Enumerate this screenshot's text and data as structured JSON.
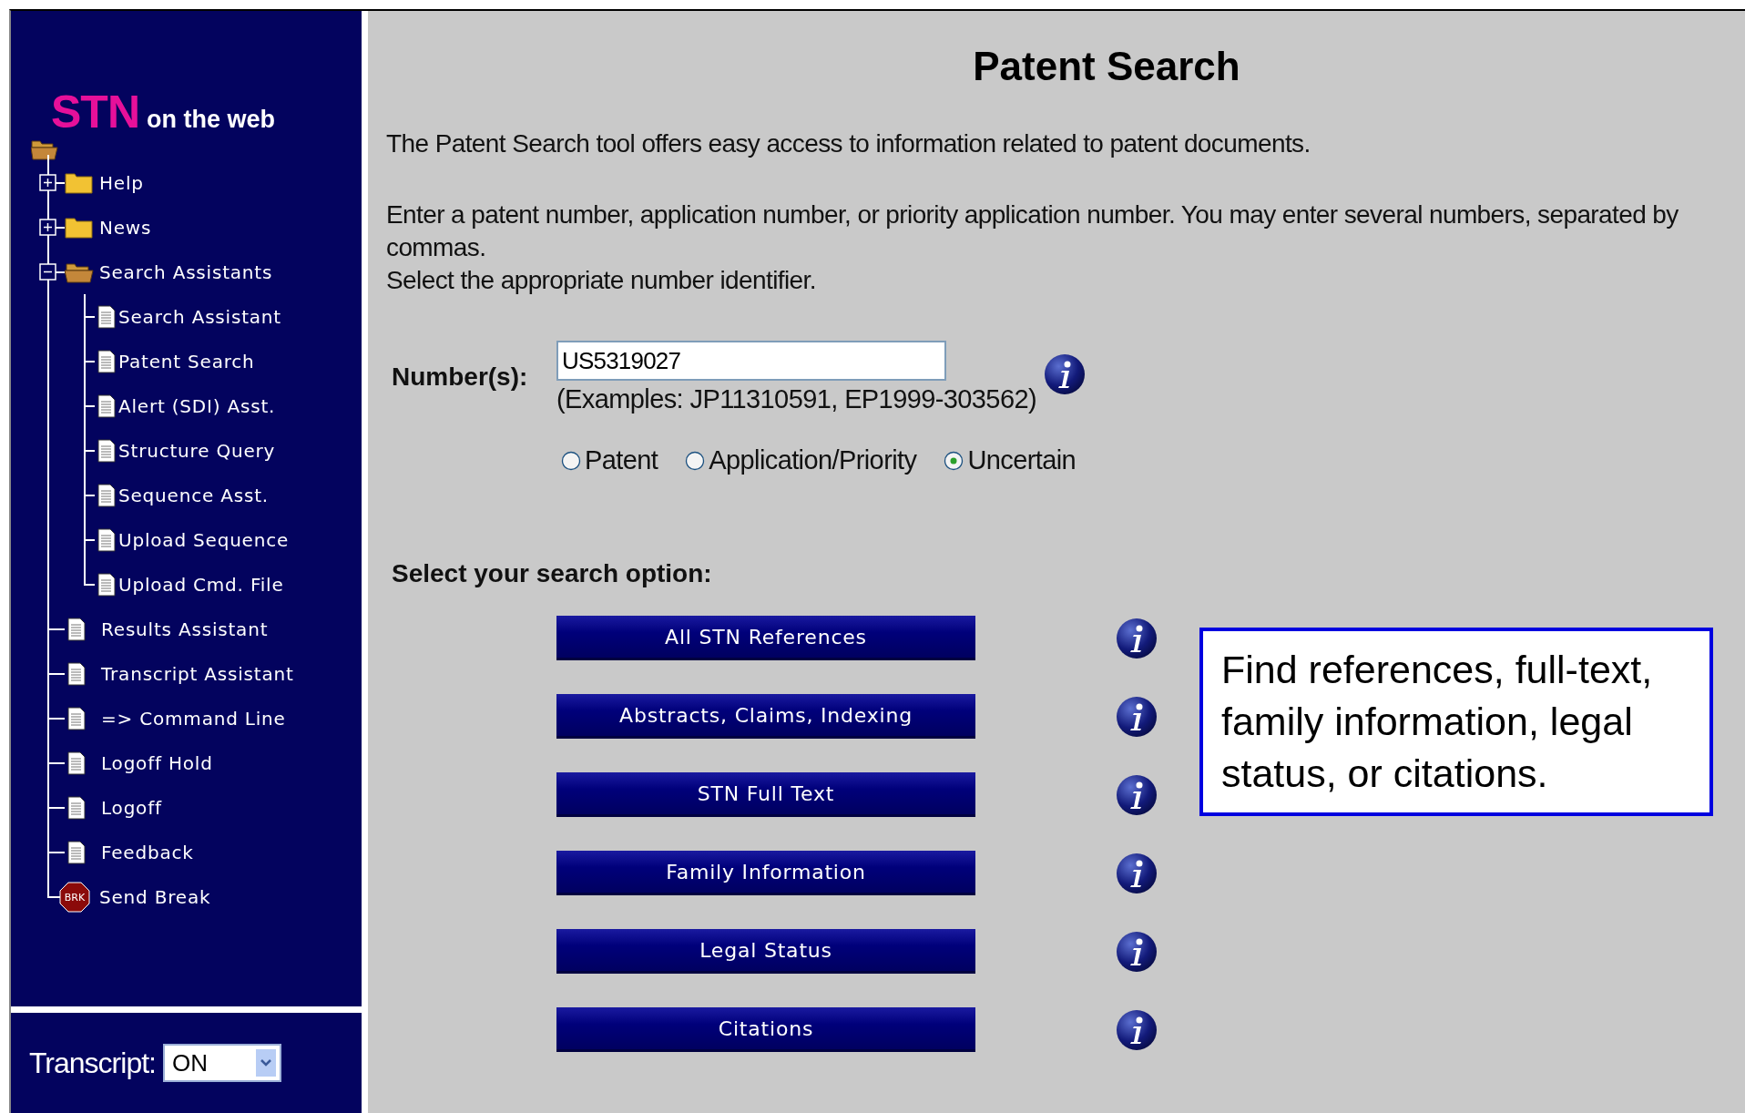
{
  "logo": {
    "brand": "STN",
    "tagline": "on the web"
  },
  "tree": [
    {
      "label": "Help",
      "kind": "folder",
      "expanded": false
    },
    {
      "label": "News",
      "kind": "folder",
      "expanded": false
    },
    {
      "label": "Search Assistants",
      "kind": "folder",
      "expanded": true,
      "children": [
        {
          "label": "Search Assistant",
          "kind": "page"
        },
        {
          "label": "Patent Search",
          "kind": "page"
        },
        {
          "label": "Alert (SDI) Asst.",
          "kind": "page"
        },
        {
          "label": "Structure Query",
          "kind": "page"
        },
        {
          "label": "Sequence Asst.",
          "kind": "page"
        },
        {
          "label": "Upload Sequence",
          "kind": "page"
        },
        {
          "label": "Upload Cmd. File",
          "kind": "page"
        }
      ]
    },
    {
      "label": "Results Assistant",
      "kind": "page"
    },
    {
      "label": "Transcript Assistant",
      "kind": "page"
    },
    {
      "label": "=> Command Line",
      "kind": "page"
    },
    {
      "label": "Logoff Hold",
      "kind": "page"
    },
    {
      "label": "Logoff",
      "kind": "page"
    },
    {
      "label": "Feedback",
      "kind": "page"
    },
    {
      "label": "Send Break",
      "kind": "break",
      "badge": "BRK"
    }
  ],
  "transcript": {
    "label": "Transcript:",
    "value": "ON"
  },
  "title": "Patent Search",
  "intro": "The Patent Search tool offers easy access to information related to patent documents.",
  "instructions": [
    "Enter a patent number, application number, or priority application number. You may enter several numbers, separated by commas.",
    "Select the appropriate number identifier."
  ],
  "number_field": {
    "label": "Number(s):",
    "value": "US5319027",
    "examples": "(Examples: JP11310591, EP1999-303562)"
  },
  "number_types": [
    {
      "label": "Patent",
      "selected": false
    },
    {
      "label": "Application/Priority",
      "selected": false
    },
    {
      "label": "Uncertain",
      "selected": true
    }
  ],
  "search_option_heading": "Select your search option:",
  "search_options": [
    "All STN References",
    "Abstracts, Claims, Indexing",
    "STN Full Text",
    "Family Information",
    "Legal Status",
    "Citations"
  ],
  "callout": "Find references, full-text, family information, legal status, or citations."
}
